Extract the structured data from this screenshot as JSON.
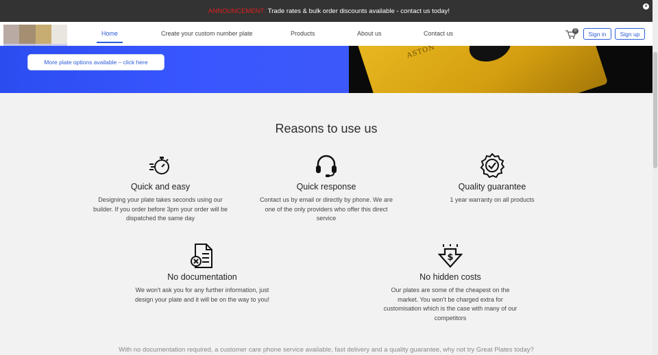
{
  "announcement": {
    "tag": "ANNOUNCEMENT:",
    "text": "Trade rates & bulk order discounts available - contact us today!",
    "close_icon": "close-icon"
  },
  "nav": {
    "items": [
      {
        "label": "Home",
        "active": true
      },
      {
        "label": "Create your custom number plate"
      },
      {
        "label": "Products"
      },
      {
        "label": "About us"
      },
      {
        "label": "Contact us"
      }
    ],
    "cart_count": "0",
    "sign_in": "Sign in",
    "sign_up": "Sign up"
  },
  "hero": {
    "button_label": "More plate options available – click here",
    "plate_text": "ASTON"
  },
  "reasons": {
    "title": "Reasons to use us",
    "features": [
      {
        "icon": "stopwatch-icon",
        "title": "Quick and easy",
        "text": "Designing your plate takes seconds using our builder. If you order before 3pm your order will be dispatched the same day"
      },
      {
        "icon": "headset-icon",
        "title": "Quick response",
        "text": "Contact us by email or directly by phone. We are one of the only providers who offer this direct service"
      },
      {
        "icon": "badge-check-icon",
        "title": "Quality guarantee",
        "text": "1 year warranty on all products"
      },
      {
        "icon": "document-cross-icon",
        "title": "No documentation",
        "text": "We won't ask you for any further information, just design your plate and it will be on the way to you!"
      },
      {
        "icon": "dollar-down-icon",
        "title": "No hidden costs",
        "text": "Our plates are some of the cheapest on the market. You won't be charged extra for customisation which is the case with many of our competitors"
      }
    ],
    "footer": "With no documentation required, a customer care phone service available, fast delivery and a quality guarantee, why not try Great Plates today?"
  },
  "colors": {
    "accent": "#2a5bd7",
    "announcement_bg": "#333333",
    "announcement_tag": "#e02020",
    "hero_blue": "#3a57ff"
  }
}
